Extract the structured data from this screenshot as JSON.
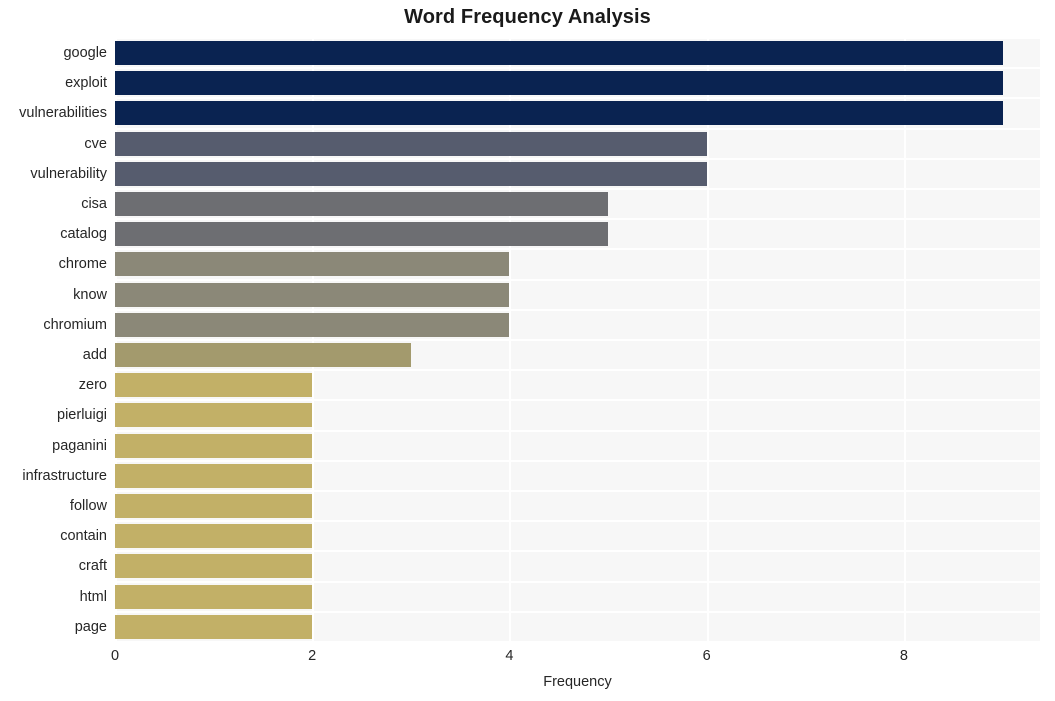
{
  "chart_data": {
    "type": "bar",
    "orientation": "horizontal",
    "title": "Word Frequency Analysis",
    "xlabel": "Frequency",
    "ylabel": "",
    "categories": [
      "google",
      "exploit",
      "vulnerabilities",
      "cve",
      "vulnerability",
      "cisa",
      "catalog",
      "chrome",
      "know",
      "chromium",
      "add",
      "zero",
      "pierluigi",
      "paganini",
      "infrastructure",
      "follow",
      "contain",
      "craft",
      "html",
      "page"
    ],
    "values": [
      9,
      9,
      9,
      6,
      6,
      5,
      5,
      4,
      4,
      4,
      3,
      2,
      2,
      2,
      2,
      2,
      2,
      2,
      2,
      2
    ],
    "bar_colors": [
      "#0a2351",
      "#0a2351",
      "#0a2351",
      "#565c6e",
      "#565c6e",
      "#6d6e72",
      "#6d6e72",
      "#8b8878",
      "#8b8878",
      "#8b8878",
      "#a39a6d",
      "#c2b067",
      "#c2b067",
      "#c2b067",
      "#c2b067",
      "#c2b067",
      "#c2b067",
      "#c2b067",
      "#c2b067",
      "#c2b067"
    ],
    "xlim": [
      0,
      9.38
    ],
    "xticks": [
      0,
      2,
      4,
      6,
      8
    ],
    "xtick_labels": [
      "0",
      "2",
      "4",
      "6",
      "8"
    ],
    "grid": true,
    "legend": "none",
    "plot_background": "#f7f7f7",
    "gridline_color": "#ffffff",
    "page_background": "#ffffff",
    "text_color": "#262626"
  }
}
